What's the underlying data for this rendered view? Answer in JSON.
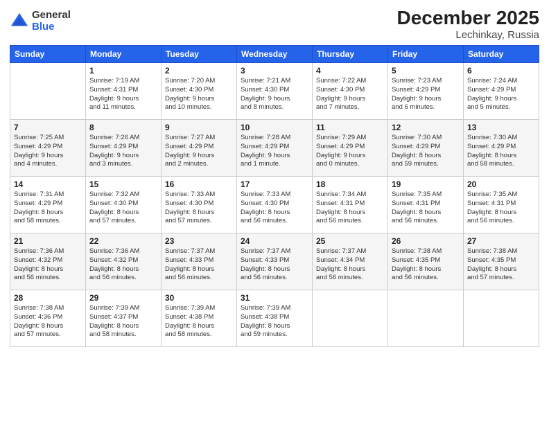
{
  "header": {
    "logo": {
      "general": "General",
      "blue": "Blue"
    },
    "title": "December 2025",
    "subtitle": "Lechinkay, Russia"
  },
  "weekdays": [
    "Sunday",
    "Monday",
    "Tuesday",
    "Wednesday",
    "Thursday",
    "Friday",
    "Saturday"
  ],
  "weeks": [
    [
      {
        "day": "",
        "info": ""
      },
      {
        "day": "1",
        "info": "Sunrise: 7:19 AM\nSunset: 4:31 PM\nDaylight: 9 hours\nand 11 minutes."
      },
      {
        "day": "2",
        "info": "Sunrise: 7:20 AM\nSunset: 4:30 PM\nDaylight: 9 hours\nand 10 minutes."
      },
      {
        "day": "3",
        "info": "Sunrise: 7:21 AM\nSunset: 4:30 PM\nDaylight: 9 hours\nand 8 minutes."
      },
      {
        "day": "4",
        "info": "Sunrise: 7:22 AM\nSunset: 4:30 PM\nDaylight: 9 hours\nand 7 minutes."
      },
      {
        "day": "5",
        "info": "Sunrise: 7:23 AM\nSunset: 4:29 PM\nDaylight: 9 hours\nand 6 minutes."
      },
      {
        "day": "6",
        "info": "Sunrise: 7:24 AM\nSunset: 4:29 PM\nDaylight: 9 hours\nand 5 minutes."
      }
    ],
    [
      {
        "day": "7",
        "info": "Sunrise: 7:25 AM\nSunset: 4:29 PM\nDaylight: 9 hours\nand 4 minutes."
      },
      {
        "day": "8",
        "info": "Sunrise: 7:26 AM\nSunset: 4:29 PM\nDaylight: 9 hours\nand 3 minutes."
      },
      {
        "day": "9",
        "info": "Sunrise: 7:27 AM\nSunset: 4:29 PM\nDaylight: 9 hours\nand 2 minutes."
      },
      {
        "day": "10",
        "info": "Sunrise: 7:28 AM\nSunset: 4:29 PM\nDaylight: 9 hours\nand 1 minute."
      },
      {
        "day": "11",
        "info": "Sunrise: 7:29 AM\nSunset: 4:29 PM\nDaylight: 9 hours\nand 0 minutes."
      },
      {
        "day": "12",
        "info": "Sunrise: 7:30 AM\nSunset: 4:29 PM\nDaylight: 8 hours\nand 59 minutes."
      },
      {
        "day": "13",
        "info": "Sunrise: 7:30 AM\nSunset: 4:29 PM\nDaylight: 8 hours\nand 58 minutes."
      }
    ],
    [
      {
        "day": "14",
        "info": "Sunrise: 7:31 AM\nSunset: 4:29 PM\nDaylight: 8 hours\nand 58 minutes."
      },
      {
        "day": "15",
        "info": "Sunrise: 7:32 AM\nSunset: 4:30 PM\nDaylight: 8 hours\nand 57 minutes."
      },
      {
        "day": "16",
        "info": "Sunrise: 7:33 AM\nSunset: 4:30 PM\nDaylight: 8 hours\nand 57 minutes."
      },
      {
        "day": "17",
        "info": "Sunrise: 7:33 AM\nSunset: 4:30 PM\nDaylight: 8 hours\nand 56 minutes."
      },
      {
        "day": "18",
        "info": "Sunrise: 7:34 AM\nSunset: 4:31 PM\nDaylight: 8 hours\nand 56 minutes."
      },
      {
        "day": "19",
        "info": "Sunrise: 7:35 AM\nSunset: 4:31 PM\nDaylight: 8 hours\nand 56 minutes."
      },
      {
        "day": "20",
        "info": "Sunrise: 7:35 AM\nSunset: 4:31 PM\nDaylight: 8 hours\nand 56 minutes."
      }
    ],
    [
      {
        "day": "21",
        "info": "Sunrise: 7:36 AM\nSunset: 4:32 PM\nDaylight: 8 hours\nand 56 minutes."
      },
      {
        "day": "22",
        "info": "Sunrise: 7:36 AM\nSunset: 4:32 PM\nDaylight: 8 hours\nand 56 minutes."
      },
      {
        "day": "23",
        "info": "Sunrise: 7:37 AM\nSunset: 4:33 PM\nDaylight: 8 hours\nand 56 minutes."
      },
      {
        "day": "24",
        "info": "Sunrise: 7:37 AM\nSunset: 4:33 PM\nDaylight: 8 hours\nand 56 minutes."
      },
      {
        "day": "25",
        "info": "Sunrise: 7:37 AM\nSunset: 4:34 PM\nDaylight: 8 hours\nand 56 minutes."
      },
      {
        "day": "26",
        "info": "Sunrise: 7:38 AM\nSunset: 4:35 PM\nDaylight: 8 hours\nand 56 minutes."
      },
      {
        "day": "27",
        "info": "Sunrise: 7:38 AM\nSunset: 4:35 PM\nDaylight: 8 hours\nand 57 minutes."
      }
    ],
    [
      {
        "day": "28",
        "info": "Sunrise: 7:38 AM\nSunset: 4:36 PM\nDaylight: 8 hours\nand 57 minutes."
      },
      {
        "day": "29",
        "info": "Sunrise: 7:39 AM\nSunset: 4:37 PM\nDaylight: 8 hours\nand 58 minutes."
      },
      {
        "day": "30",
        "info": "Sunrise: 7:39 AM\nSunset: 4:38 PM\nDaylight: 8 hours\nand 58 minutes."
      },
      {
        "day": "31",
        "info": "Sunrise: 7:39 AM\nSunset: 4:38 PM\nDaylight: 8 hours\nand 59 minutes."
      },
      {
        "day": "",
        "info": ""
      },
      {
        "day": "",
        "info": ""
      },
      {
        "day": "",
        "info": ""
      }
    ]
  ]
}
